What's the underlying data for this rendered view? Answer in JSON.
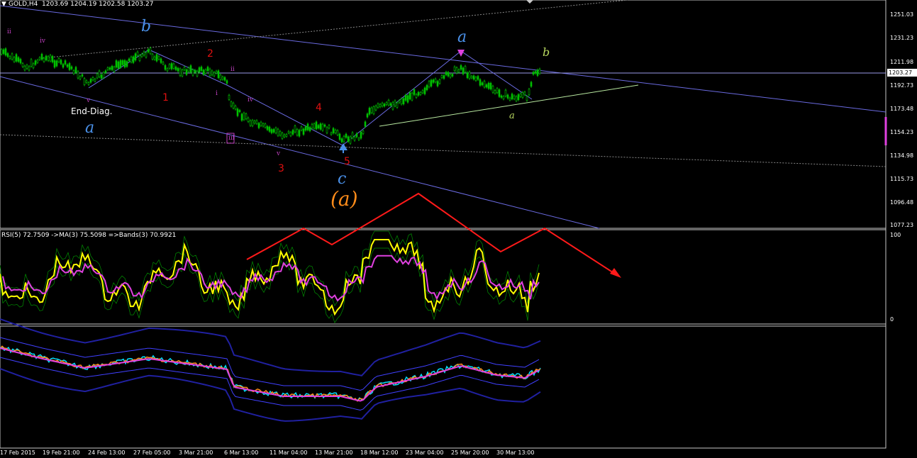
{
  "header": {
    "menu_icon": "triangle-down-icon",
    "symbol": "GOLD,H4",
    "ohlc": "1203.69 1204.19 1202.58 1203.27"
  },
  "price_axis": {
    "ticks": [
      "1251.03",
      "1231.23",
      "1211.98",
      "1192.73",
      "1173.48",
      "1154.23",
      "1134.98",
      "1115.73",
      "1096.48",
      "1077.23"
    ],
    "current": "1203.27"
  },
  "time_axis": {
    "ticks": [
      "17 Feb 2015",
      "19 Feb 21:00",
      "24 Feb 13:00",
      "27 Feb 05:00",
      "3 Mar 21:00",
      "6 Mar 13:00",
      "11 Mar 04:00",
      "13 Mar 21:00",
      "18 Mar 12:00",
      "23 Mar 04:00",
      "25 Mar 20:00",
      "30 Mar 13:00"
    ]
  },
  "rsi_panel": {
    "label": "RSI(5) 72.7509  ->MA(3) 75.5098  =>Bands(3) 70.9921",
    "top_value": "100",
    "bottom_value": "0"
  },
  "wave_labels": {
    "ii_top": "ii",
    "iv_top": "iv",
    "b_big": "b",
    "v_small": "v",
    "end_diag": "End-Diag.",
    "a_left": "a",
    "red_2": "2",
    "red_1": "1",
    "ii_mid": "ii",
    "i_small": "i",
    "iv_mid": "iv",
    "iii_box": "iii",
    "v_mid": "v",
    "red_3": "3",
    "red_4": "4",
    "red_5": "5",
    "c_label": "c",
    "a_paren": "(a)",
    "a_top": "a",
    "b_green": "b",
    "a_green": "a"
  },
  "colors": {
    "background": "#000000",
    "candles": "#00c000",
    "channel": "#6a6ae0",
    "rsi_line": "#ffff00",
    "rsi_ma": "#e040e0",
    "bands": "#009000",
    "forecast_arrow": "#ff1a1a",
    "wave_blue": "#4a90e8",
    "wave_red": "#e01010",
    "wave_orange": "#ff8c1a",
    "wave_magenta": "#c040c0",
    "wave_green": "#b8d860"
  }
}
